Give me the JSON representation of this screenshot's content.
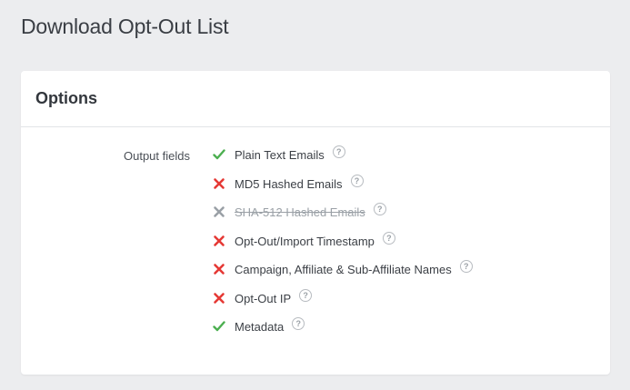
{
  "page": {
    "title": "Download Opt-Out List"
  },
  "options_card": {
    "title": "Options",
    "field_label": "Output fields",
    "help_glyph": "?",
    "fields": [
      {
        "label": "Plain Text Emails",
        "status": "enabled",
        "icon": "check-icon"
      },
      {
        "label": "MD5 Hashed Emails",
        "status": "excluded",
        "icon": "x-icon"
      },
      {
        "label": "SHA-512 Hashed Emails",
        "status": "disabled",
        "icon": "x-icon"
      },
      {
        "label": "Opt-Out/Import Timestamp",
        "status": "excluded",
        "icon": "x-icon"
      },
      {
        "label": "Campaign, Affiliate & Sub-Affiliate Names",
        "status": "excluded",
        "icon": "x-icon"
      },
      {
        "label": "Opt-Out IP",
        "status": "excluded",
        "icon": "x-icon"
      },
      {
        "label": "Metadata",
        "status": "enabled",
        "icon": "check-icon"
      }
    ]
  },
  "colors": {
    "check": "#4caf50",
    "excluded": "#e53935",
    "disabled": "#9aa0a6"
  }
}
